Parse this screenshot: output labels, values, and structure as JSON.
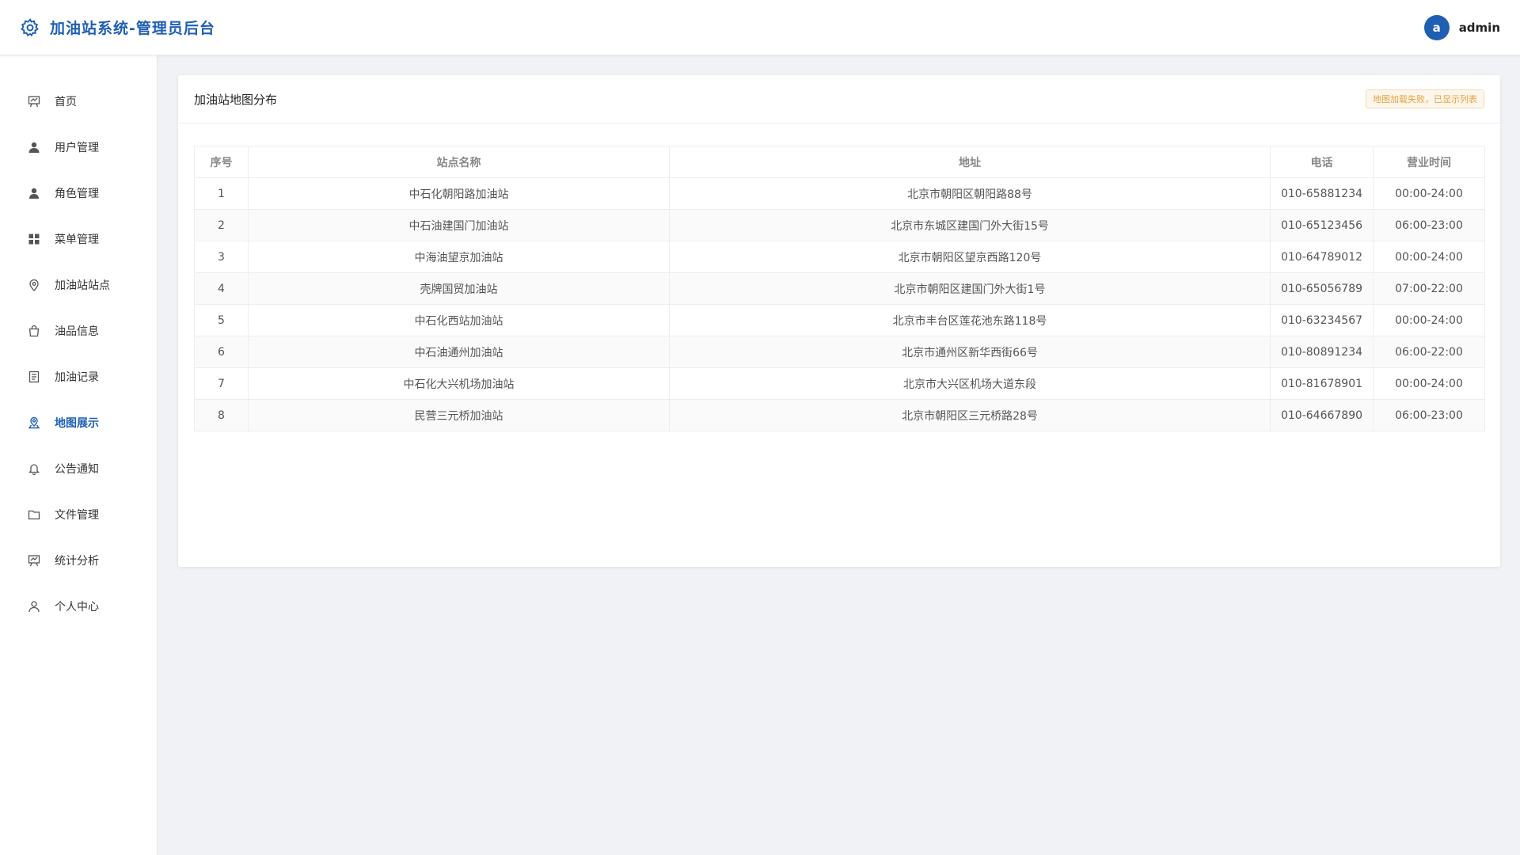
{
  "header": {
    "title": "加油站系统-管理员后台",
    "avatar_letter": "a",
    "username": "admin"
  },
  "sidebar": {
    "items": [
      {
        "label": "首页",
        "icon": "dashboard-icon"
      },
      {
        "label": "用户管理",
        "icon": "user-icon"
      },
      {
        "label": "角色管理",
        "icon": "role-icon"
      },
      {
        "label": "菜单管理",
        "icon": "grid-icon"
      },
      {
        "label": "加油站站点",
        "icon": "location-pin-icon"
      },
      {
        "label": "油品信息",
        "icon": "bag-icon"
      },
      {
        "label": "加油记录",
        "icon": "document-icon"
      },
      {
        "label": "地图展示",
        "icon": "map-pin-icon",
        "active": true
      },
      {
        "label": "公告通知",
        "icon": "bell-icon"
      },
      {
        "label": "文件管理",
        "icon": "folder-icon"
      },
      {
        "label": "统计分析",
        "icon": "chart-board-icon"
      },
      {
        "label": "个人中心",
        "icon": "person-outline-icon"
      }
    ]
  },
  "main": {
    "card_title": "加油站地图分布",
    "warning": "地图加载失败，已显示列表",
    "table": {
      "columns": [
        "序号",
        "站点名称",
        "地址",
        "电话",
        "营业时间"
      ],
      "rows": [
        [
          "1",
          "中石化朝阳路加油站",
          "北京市朝阳区朝阳路88号",
          "010-65881234",
          "00:00-24:00"
        ],
        [
          "2",
          "中石油建国门加油站",
          "北京市东城区建国门外大街15号",
          "010-65123456",
          "06:00-23:00"
        ],
        [
          "3",
          "中海油望京加油站",
          "北京市朝阳区望京西路120号",
          "010-64789012",
          "00:00-24:00"
        ],
        [
          "4",
          "壳牌国贸加油站",
          "北京市朝阳区建国门外大街1号",
          "010-65056789",
          "07:00-22:00"
        ],
        [
          "5",
          "中石化西站加油站",
          "北京市丰台区莲花池东路118号",
          "010-63234567",
          "00:00-24:00"
        ],
        [
          "6",
          "中石油通州加油站",
          "北京市通州区新华西街66号",
          "010-80891234",
          "06:00-22:00"
        ],
        [
          "7",
          "中石化大兴机场加油站",
          "北京市大兴区机场大道东段",
          "010-81678901",
          "00:00-24:00"
        ],
        [
          "8",
          "民营三元桥加油站",
          "北京市朝阳区三元桥路28号",
          "010-64667890",
          "06:00-23:00"
        ]
      ]
    }
  },
  "colors": {
    "accent": "#1f5fb3",
    "warning_text": "#e6a23c",
    "page_bg": "#f0f2f5"
  }
}
